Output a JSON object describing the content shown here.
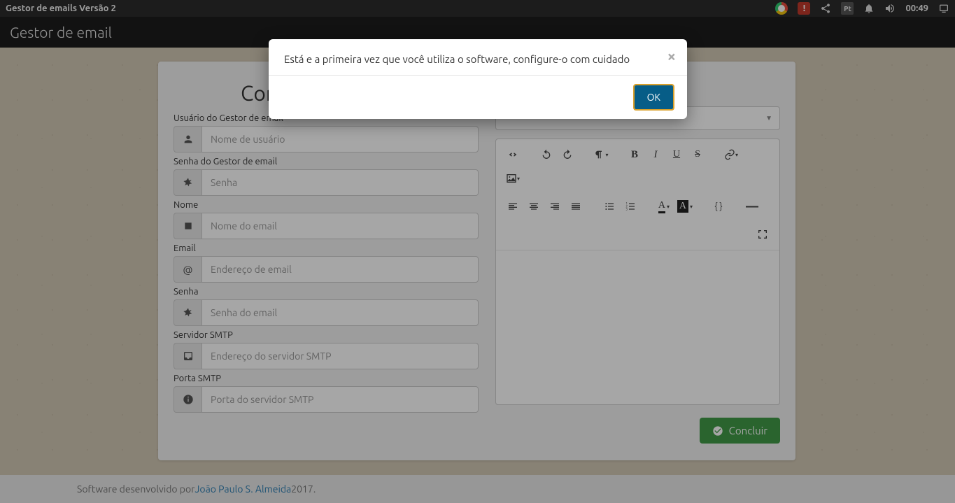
{
  "os": {
    "window_title": "Gestor de emails Versão 2",
    "lang_indicator": "Pt",
    "clock": "00:49"
  },
  "app": {
    "header": "Gestor de email"
  },
  "config": {
    "title": "Conf",
    "fields": {
      "user_label": "Usuário do Gestor de email",
      "user_placeholder": "Nome de usuário",
      "pass_label": "Senha do Gestor de email",
      "pass_placeholder": "Senha",
      "name_label": "Nome",
      "name_placeholder": "Nome do email",
      "email_label": "Email",
      "email_placeholder": "Endereço de email",
      "emailpass_label": "Senha",
      "emailpass_placeholder": "Senha do email",
      "smtp_label": "Servidor SMTP",
      "smtp_placeholder": "Endereço do servidor SMTP",
      "port_label": "Porta SMTP",
      "port_placeholder": "Porta do servidor SMTP"
    }
  },
  "editor": {
    "select_placeholder": "",
    "tools": {
      "code": "Code view",
      "undo": "Undo",
      "redo": "Redo",
      "para": "Paragraph format",
      "bold": "B",
      "italic": "I",
      "underline": "U",
      "strike": "S",
      "link": "Link",
      "image": "Image",
      "alignl": "Align left",
      "alignc": "Align center",
      "alignr": "Align right",
      "alignj": "Justify",
      "ul": "Unordered list",
      "ol": "Ordered list",
      "font": "A",
      "bg": "A",
      "braces": "{ }",
      "hr": "—",
      "expand": "Fullscreen"
    }
  },
  "actions": {
    "concluir": "Concluir"
  },
  "footer": {
    "prefix": "Software desenvolvido por ",
    "author": "João Paulo S. Almeida",
    "suffix": " 2017."
  },
  "modal": {
    "message": "Está e a primeira vez que você utiliza o software, configure-o com cuidado",
    "ok": "OK"
  }
}
